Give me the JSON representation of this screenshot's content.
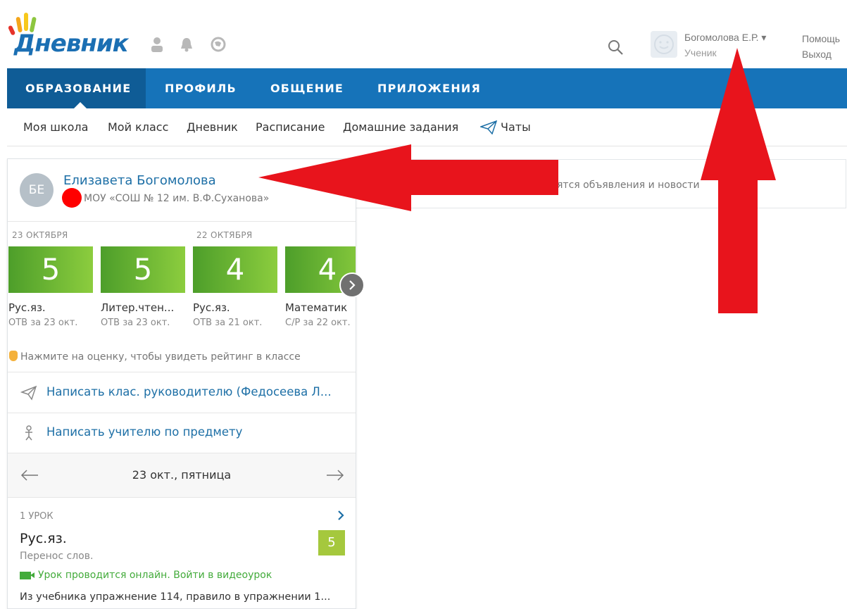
{
  "header": {
    "logo_text": "Дневник",
    "user_name": "Богомолова Е.Р. ▾",
    "user_role": "Ученик",
    "help": "Помощь",
    "logout": "Выход"
  },
  "nav": {
    "items": [
      "ОБРАЗОВАНИЕ",
      "ПРОФИЛЬ",
      "ОБЩЕНИЕ",
      "ПРИЛОЖЕНИЯ"
    ],
    "active": "ОБРАЗОВАНИЕ"
  },
  "subnav": {
    "items": [
      "Моя школа",
      "Мой класс",
      "Дневник",
      "Расписание",
      "Домашние задания",
      "Чаты"
    ]
  },
  "profile": {
    "initials": "БЕ",
    "name": "Елизавета Богомолова",
    "school": "МОУ «СОШ № 12 им. В.Ф.Суханова»"
  },
  "grades": {
    "dates": [
      "23 ОКТЯБРЯ",
      "22 ОКТЯБРЯ"
    ],
    "items": [
      {
        "value": "5",
        "subject": "Рус.яз.",
        "type": "ОТВ за 23 окт."
      },
      {
        "value": "5",
        "subject": "Литер.чтен...",
        "type": "ОТВ за 23 окт."
      },
      {
        "value": "4",
        "subject": "Рус.яз.",
        "type": "ОТВ за 21 окт."
      },
      {
        "value": "4",
        "subject": "Математик",
        "type": "С/Р за 22 окт."
      }
    ],
    "hint": "Нажмите на оценку, чтобы увидеть рейтинг в классе"
  },
  "actions": {
    "write_class_teacher": "Написать клас. руководителю (Федосеева Л...",
    "write_subject_teacher": "Написать учителю по предмету"
  },
  "day": {
    "label": "23 окт., пятница"
  },
  "lesson": {
    "number": "1 УРОК",
    "subject": "Рус.яз.",
    "topic": "Перенос слов.",
    "grade": "5",
    "online": "Урок проводится онлайн. Войти в видеоурок",
    "homework": "Из учебника упражнение 114, правило в упражнении 1..."
  },
  "news": {
    "text": "ятся объявления и новости"
  },
  "colors": {
    "nav": "#1673b9",
    "nav_active": "#0f5c96",
    "link": "#1d6fa6",
    "grade_green": "#6fbe35",
    "lesson_grade": "#a5c83d",
    "annotation_red": "#e8141c"
  }
}
